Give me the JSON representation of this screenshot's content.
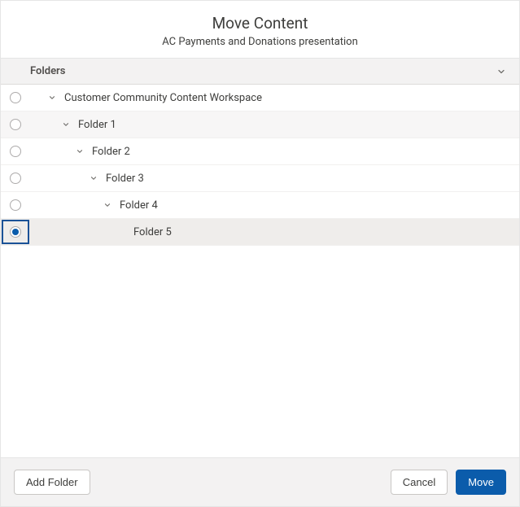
{
  "header": {
    "title": "Move Content",
    "subtitle": "AC Payments and Donations presentation"
  },
  "list_header": {
    "label": "Folders"
  },
  "tree": {
    "items": [
      {
        "label": "Customer Community Content Workspace",
        "depth": 0,
        "expandable": true,
        "selected": false,
        "shade": false
      },
      {
        "label": "Folder 1",
        "depth": 1,
        "expandable": true,
        "selected": false,
        "shade": true
      },
      {
        "label": "Folder 2",
        "depth": 2,
        "expandable": true,
        "selected": false,
        "shade": false
      },
      {
        "label": "Folder 3",
        "depth": 3,
        "expandable": true,
        "selected": false,
        "shade": false
      },
      {
        "label": "Folder 4",
        "depth": 4,
        "expandable": true,
        "selected": false,
        "shade": false
      },
      {
        "label": "Folder 5",
        "depth": 5,
        "expandable": false,
        "selected": true,
        "shade": false
      }
    ]
  },
  "footer": {
    "add_folder": "Add Folder",
    "cancel": "Cancel",
    "move": "Move"
  }
}
